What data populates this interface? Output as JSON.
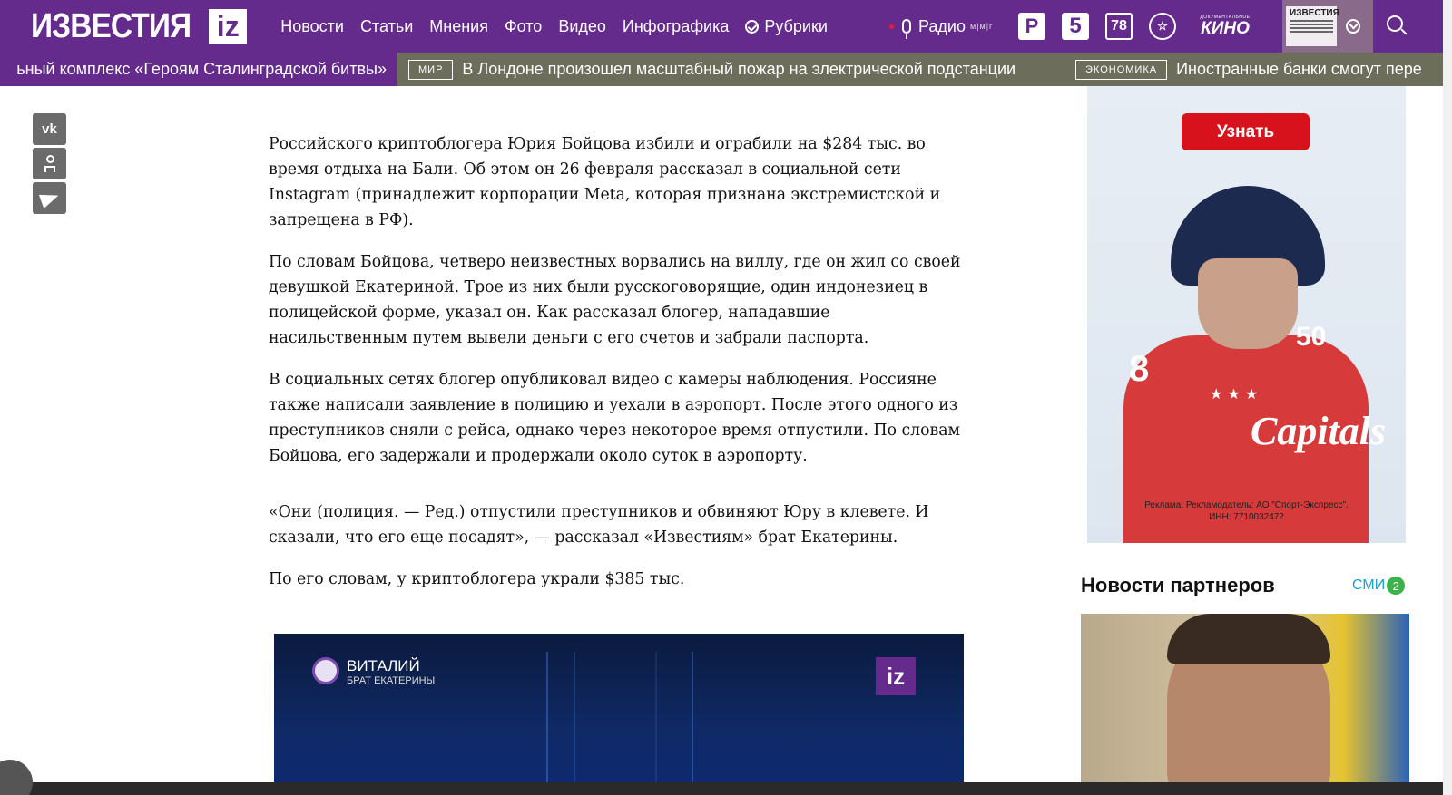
{
  "header": {
    "logo_text": "ИЗВЕСТИЯ",
    "logo_badge": "iz",
    "nav": [
      "Новости",
      "Статьи",
      "Мнения",
      "Фото",
      "Видео",
      "Инфографика"
    ],
    "rubriki": "Рубрики",
    "radio": "Радио",
    "radio_freq": "м|м|г",
    "channels": [
      "Р",
      "5",
      "78",
      "☆",
      "КИНО"
    ],
    "channel_kino_small": "ДОКУМЕНТАЛЬНОЕ",
    "paper_title": "ИЗВЕСТИЯ",
    "colors": {
      "brand": "#642a8c",
      "ticker": "#6d6d5c"
    }
  },
  "ticker": {
    "first": "ьный комплекс «Героям Сталинградской битвы»",
    "items": [
      {
        "tag": "МИР",
        "text": "В Лондоне произошел масштабный пожар на электрической подстанции"
      },
      {
        "tag": "ЭКОНОМИКА",
        "text": "Иностранные банки смогут пере"
      }
    ]
  },
  "social": {
    "vk": "vk"
  },
  "article": {
    "paragraphs": [
      "Российского криптоблогера Юрия Бойцова избили и ограбили на $284 тыс. во время отдыха на Бали. Об этом он 26 февраля рассказал в социальной сети Instagram (принадлежит корпорации Meta, которая признана экстремистской и запрещена в РФ).",
      "По словам Бойцова, четверо неизвестных ворвались на виллу, где он жил со своей девушкой Екатериной. Трое из них были русскоговорящие, один индонезиец в полицейской форме, указал он. Как рассказал блогер, нападавшие насильственным путем вывели деньги с его счетов и забрали паспорта.",
      "В социальных сетях блогер опубликовал видео с камеры наблюдения. Россияне также написали заявление в полицию и уехали в аэропорт. После этого одного из преступников сняли с рейса, однако через некоторое время отпустили. По словам Бойцова, его задержали и продержали около суток в аэропорту.",
      "«Они (полиция. — Ред.) отпустили преступников и обвиняют Юру в клевете. И сказали, что его еще посадят», — рассказал «Известиям» брат Екатерины.",
      "По его словам, у криптоблогера украли $385 тыс."
    ],
    "video": {
      "caller_name": "ВИТАЛИЙ",
      "caller_sub": "БРАТ ЕКАТЕРИНЫ",
      "logo": "iz"
    }
  },
  "ad": {
    "button": "Узнать",
    "jersey_number": "8",
    "jersey_50": "50",
    "jersey_word": "Capitals",
    "stars": "★ ★ ★",
    "disclaimer_line1": "Реклама. Рекламодатель: АО \"Спорт-Экспресс\".",
    "disclaimer_line2": "ИНН: 7710032472"
  },
  "partners": {
    "title": "Новости партнеров",
    "smi_label": "СМИ",
    "smi_count": "2"
  }
}
